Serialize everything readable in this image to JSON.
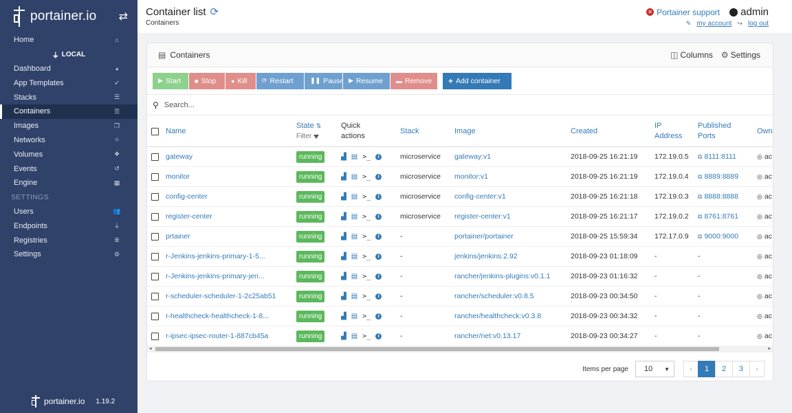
{
  "sidebar": {
    "brand": "portainer.io",
    "items_top": [
      {
        "label": "Home",
        "icon": "home-icon",
        "glyph": "⌂"
      }
    ],
    "endpoint": "LOCAL",
    "items": [
      {
        "label": "Dashboard",
        "icon": "dashboard-icon",
        "glyph": "◕"
      },
      {
        "label": "App Templates",
        "icon": "rocket-icon",
        "glyph": "➶"
      },
      {
        "label": "Stacks",
        "icon": "list-icon",
        "glyph": "☰"
      },
      {
        "label": "Containers",
        "icon": "server-icon",
        "glyph": "☰"
      },
      {
        "label": "Images",
        "icon": "clone-icon",
        "glyph": "❐"
      },
      {
        "label": "Networks",
        "icon": "sitemap-icon",
        "glyph": "⊹"
      },
      {
        "label": "Volumes",
        "icon": "cubes-icon",
        "glyph": "❖"
      },
      {
        "label": "Events",
        "icon": "history-icon",
        "glyph": "↺"
      },
      {
        "label": "Engine",
        "icon": "th-icon",
        "glyph": "▦"
      }
    ],
    "section": "SETTINGS",
    "settings_items": [
      {
        "label": "Users",
        "icon": "users-icon",
        "glyph": "👥"
      },
      {
        "label": "Endpoints",
        "icon": "plug-icon",
        "glyph": "⏚"
      },
      {
        "label": "Registries",
        "icon": "database-icon",
        "glyph": "≣"
      },
      {
        "label": "Settings",
        "icon": "cogs-icon",
        "glyph": "⚙"
      }
    ],
    "footer_brand": "portainer.io",
    "version": "1.19.2"
  },
  "header": {
    "title": "Container list",
    "breadcrumb": "Containers",
    "support": "Portainer support",
    "user": "admin",
    "my_account": "my account",
    "log_out": "log out"
  },
  "widget": {
    "title": "Containers",
    "columns_label": "Columns",
    "settings_label": "Settings",
    "buttons": {
      "start": "Start",
      "stop": "Stop",
      "kill": "Kill",
      "restart": "Restart",
      "pause": "Pause",
      "resume": "Resume",
      "remove": "Remove",
      "add": "Add container"
    },
    "search_placeholder": "Search...",
    "columns": {
      "name": "Name",
      "state": "State",
      "filter": "Filter",
      "quick1": "Quick",
      "quick2": "actions",
      "stack": "Stack",
      "image": "Image",
      "created": "Created",
      "ip1": "IP",
      "ip2": "Address",
      "ports1": "Published",
      "ports2": "Ports",
      "owner": "Own"
    }
  },
  "rows": [
    {
      "name": "gateway",
      "state": "running",
      "stack": "microservice",
      "image": "gateway:v1",
      "created": "2018-09-25 16:21:19",
      "ip": "172.19.0.5",
      "ports": "8111:8111",
      "owner": "ac"
    },
    {
      "name": "monitor",
      "state": "running",
      "stack": "microservice",
      "image": "monitor:v1",
      "created": "2018-09-25 16:21:19",
      "ip": "172.19.0.4",
      "ports": "8889:8889",
      "owner": "ac"
    },
    {
      "name": "config-center",
      "state": "running",
      "stack": "microservice",
      "image": "config-center:v1",
      "created": "2018-09-25 16:21:18",
      "ip": "172.19.0.3",
      "ports": "8888:8888",
      "owner": "ac"
    },
    {
      "name": "register-center",
      "state": "running",
      "stack": "microservice",
      "image": "register-center:v1",
      "created": "2018-09-25 16:21:17",
      "ip": "172.19.0.2",
      "ports": "8761:8761",
      "owner": "ac"
    },
    {
      "name": "prtainer",
      "state": "running",
      "stack": "-",
      "image": "portainer/portainer",
      "created": "2018-09-25 15:59:34",
      "ip": "172.17.0.9",
      "ports": "9000:9000",
      "owner": "ac"
    },
    {
      "name": "r-Jenkins-jenkins-primary-1-5...",
      "state": "running",
      "stack": "-",
      "image": "jenkins/jenkins:2.92",
      "created": "2018-09-23 01:18:09",
      "ip": "-",
      "ports": "-",
      "owner": "ac"
    },
    {
      "name": "r-Jenkins-jenkins-primary-jen...",
      "state": "running",
      "stack": "-",
      "image": "rancher/jenkins-plugins:v0.1.1",
      "created": "2018-09-23 01:16:32",
      "ip": "-",
      "ports": "-",
      "owner": "ac"
    },
    {
      "name": "r-scheduler-scheduler-1-2c25ab51",
      "state": "running",
      "stack": "-",
      "image": "rancher/scheduler:v0.8.5",
      "created": "2018-09-23 00:34:50",
      "ip": "-",
      "ports": "-",
      "owner": "ac"
    },
    {
      "name": "r-healthcheck-healthcheck-1-8...",
      "state": "running",
      "stack": "-",
      "image": "rancher/healthcheck:v0.3.8",
      "created": "2018-09-23 00:34:32",
      "ip": "-",
      "ports": "-",
      "owner": "ac"
    },
    {
      "name": "r-ipsec-ipsec-router-1-887cb45a",
      "state": "running",
      "stack": "-",
      "image": "rancher/net:v0.13.17",
      "created": "2018-09-23 00:34:27",
      "ip": "-",
      "ports": "-",
      "owner": "ac"
    }
  ],
  "pagination": {
    "items_per_page_label": "Items per page",
    "items_per_page": "10",
    "prev": "‹",
    "pages": [
      "1",
      "2",
      "3"
    ],
    "next": "›",
    "active_page": "1"
  },
  "colors": {
    "sidebar": "#30426a",
    "primary": "#337ab7",
    "running": "#5cb85c"
  }
}
